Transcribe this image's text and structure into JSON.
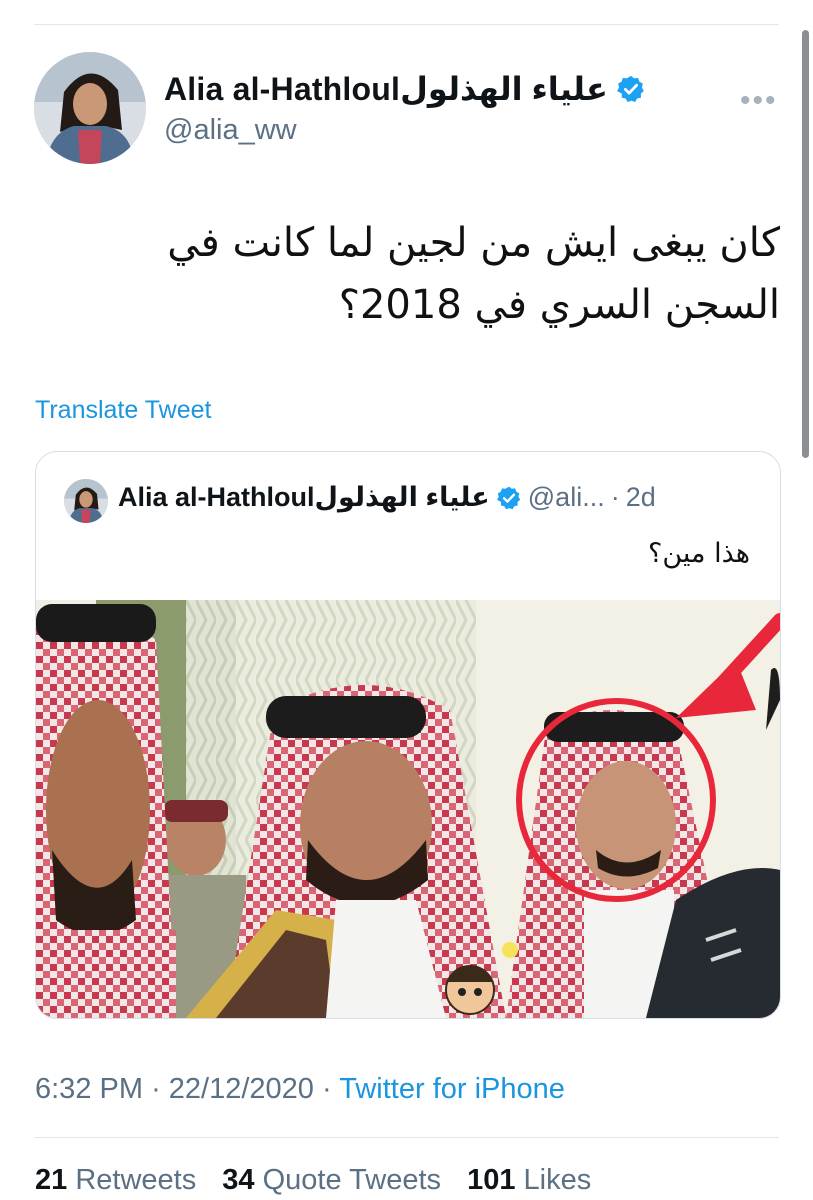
{
  "author": {
    "display_name": "Alia al-Hathloulعلياء الهذلول",
    "handle": "@alia_ww"
  },
  "tweet": {
    "text": "كان يبغى ايش من لجين لما كانت في السجن السري في 2018؟",
    "translate_label": "Translate Tweet"
  },
  "quoted_tweet": {
    "display_name": "Alia al-Hathloulعلياء الهذلول",
    "handle": "@ali...",
    "separator": "·",
    "time": "2d",
    "text": "هذا مين؟"
  },
  "meta": {
    "time": "6:32 PM",
    "date": "22/12/2020",
    "separator": "·",
    "source": "Twitter for iPhone"
  },
  "stats": {
    "retweets_count": "21",
    "retweets_label": "Retweets",
    "quote_tweets_count": "34",
    "quote_tweets_label": "Quote Tweets",
    "likes_count": "101",
    "likes_label": "Likes"
  },
  "icons": {
    "verified": "verified-badge-icon",
    "more": "more-options-icon"
  },
  "colors": {
    "link": "#1b95e0",
    "secondary_text": "#5b7083",
    "verified": "#1da1f2",
    "annotation_red": "#e8283a"
  }
}
